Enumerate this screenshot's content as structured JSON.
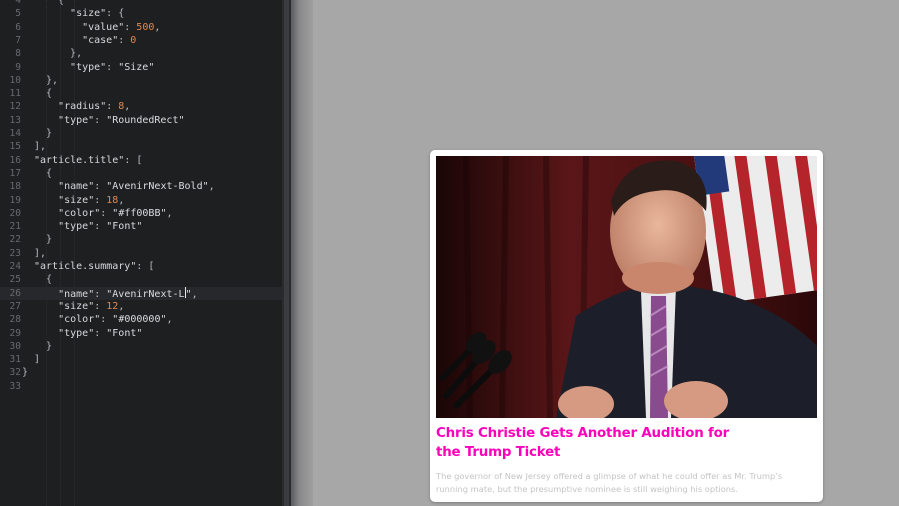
{
  "editor": {
    "lines": [
      {
        "n": "4",
        "code": [
          [
            "{",
            "p"
          ]
        ]
      },
      {
        "n": "5",
        "code": [
          [
            "  ",
            ""
          ],
          [
            "\"size\"",
            "key"
          ],
          [
            ": {",
            "p"
          ]
        ]
      },
      {
        "n": "6",
        "code": [
          [
            "    ",
            ""
          ],
          [
            "\"value\"",
            "key"
          ],
          [
            ": ",
            "p"
          ],
          [
            "500",
            "num"
          ],
          [
            ",",
            "p"
          ]
        ]
      },
      {
        "n": "7",
        "code": [
          [
            "    ",
            ""
          ],
          [
            "\"case\"",
            "key"
          ],
          [
            ": ",
            "p"
          ],
          [
            "0",
            "num"
          ]
        ]
      },
      {
        "n": "8",
        "code": [
          [
            "  ",
            ""
          ],
          [
            "},",
            "p"
          ]
        ]
      },
      {
        "n": "9",
        "code": [
          [
            "  ",
            ""
          ],
          [
            "\"type\"",
            "key"
          ],
          [
            ": ",
            "p"
          ],
          [
            "\"Size\"",
            "str"
          ]
        ]
      },
      {
        "n": "10",
        "code": [
          [
            "},",
            "p"
          ]
        ]
      },
      {
        "n": "11",
        "code": [
          [
            "{",
            "p"
          ]
        ]
      },
      {
        "n": "12",
        "code": [
          [
            "  ",
            ""
          ],
          [
            "\"radius\"",
            "key"
          ],
          [
            ": ",
            "p"
          ],
          [
            "8",
            "num"
          ],
          [
            ",",
            "p"
          ]
        ]
      },
      {
        "n": "13",
        "code": [
          [
            "  ",
            ""
          ],
          [
            "\"type\"",
            "key"
          ],
          [
            ": ",
            "p"
          ],
          [
            "\"RoundedRect\"",
            "str"
          ]
        ]
      },
      {
        "n": "14",
        "code": [
          [
            "}",
            "p"
          ]
        ]
      },
      {
        "n": "15",
        "code": [
          [
            "],",
            "p"
          ]
        ]
      },
      {
        "n": "16",
        "code": [
          [
            "\"article.title\"",
            "key"
          ],
          [
            ": [",
            "p"
          ]
        ]
      },
      {
        "n": "17",
        "code": [
          [
            "  {",
            "p"
          ]
        ]
      },
      {
        "n": "18",
        "code": [
          [
            "    ",
            ""
          ],
          [
            "\"name\"",
            "key"
          ],
          [
            ": ",
            "p"
          ],
          [
            "\"AvenirNext-Bold\"",
            "str"
          ],
          [
            ",",
            "p"
          ]
        ]
      },
      {
        "n": "19",
        "code": [
          [
            "    ",
            ""
          ],
          [
            "\"size\"",
            "key"
          ],
          [
            ": ",
            "p"
          ],
          [
            "18",
            "num"
          ],
          [
            ",",
            "p"
          ]
        ]
      },
      {
        "n": "20",
        "code": [
          [
            "    ",
            ""
          ],
          [
            "\"color\"",
            "key"
          ],
          [
            ": ",
            "p"
          ],
          [
            "\"#ff00BB\"",
            "str"
          ],
          [
            ",",
            "p"
          ]
        ]
      },
      {
        "n": "21",
        "code": [
          [
            "    ",
            ""
          ],
          [
            "\"type\"",
            "key"
          ],
          [
            ": ",
            "p"
          ],
          [
            "\"Font\"",
            "str"
          ]
        ]
      },
      {
        "n": "22",
        "code": [
          [
            "  }",
            "p"
          ]
        ]
      },
      {
        "n": "23",
        "code": [
          [
            "],",
            "p"
          ]
        ]
      },
      {
        "n": "24",
        "code": [
          [
            "\"article.summary\"",
            "key"
          ],
          [
            ": [",
            "p"
          ]
        ]
      },
      {
        "n": "25",
        "code": [
          [
            "  {",
            "p"
          ]
        ]
      },
      {
        "n": "26",
        "code": [
          [
            "    ",
            ""
          ],
          [
            "\"name\"",
            "key"
          ],
          [
            ": ",
            "p"
          ],
          [
            "\"AvenirNext-L",
            "str"
          ],
          [
            "|",
            "cursor"
          ],
          [
            "\"",
            "str"
          ],
          [
            ",",
            "p"
          ]
        ]
      },
      {
        "n": "27",
        "code": [
          [
            "    ",
            ""
          ],
          [
            "\"size\"",
            "key"
          ],
          [
            ": ",
            "p"
          ],
          [
            "12",
            "num"
          ],
          [
            ",",
            "p"
          ]
        ]
      },
      {
        "n": "28",
        "code": [
          [
            "    ",
            ""
          ],
          [
            "\"color\"",
            "key"
          ],
          [
            ": ",
            "p"
          ],
          [
            "\"#000000\"",
            "str"
          ],
          [
            ",",
            "p"
          ]
        ]
      },
      {
        "n": "29",
        "code": [
          [
            "    ",
            ""
          ],
          [
            "\"type\"",
            "key"
          ],
          [
            ": ",
            "p"
          ],
          [
            "\"Font\"",
            "str"
          ]
        ]
      },
      {
        "n": "30",
        "code": [
          [
            "  }",
            "p"
          ]
        ]
      },
      {
        "n": "31",
        "code": [
          [
            "]",
            "p"
          ]
        ]
      },
      {
        "n": "32",
        "code": [
          [
            "}",
            "p"
          ]
        ]
      },
      {
        "n": "33",
        "code": []
      }
    ],
    "active_line": "26"
  },
  "article": {
    "title": "Chris Christie Gets Another Audition for the Trump Ticket",
    "summary": "The governor of New Jersey offered a glimpse of what he could offer as Mr. Trump’s running mate, but the presumptive nominee is still weighing his options.",
    "image_icon": "news-photo-icon",
    "title_color": "#ff00bb"
  },
  "colors": {
    "editor_bg": "#1e1f21",
    "preview_bg": "#a7a7a7",
    "number": "#e0894f"
  }
}
